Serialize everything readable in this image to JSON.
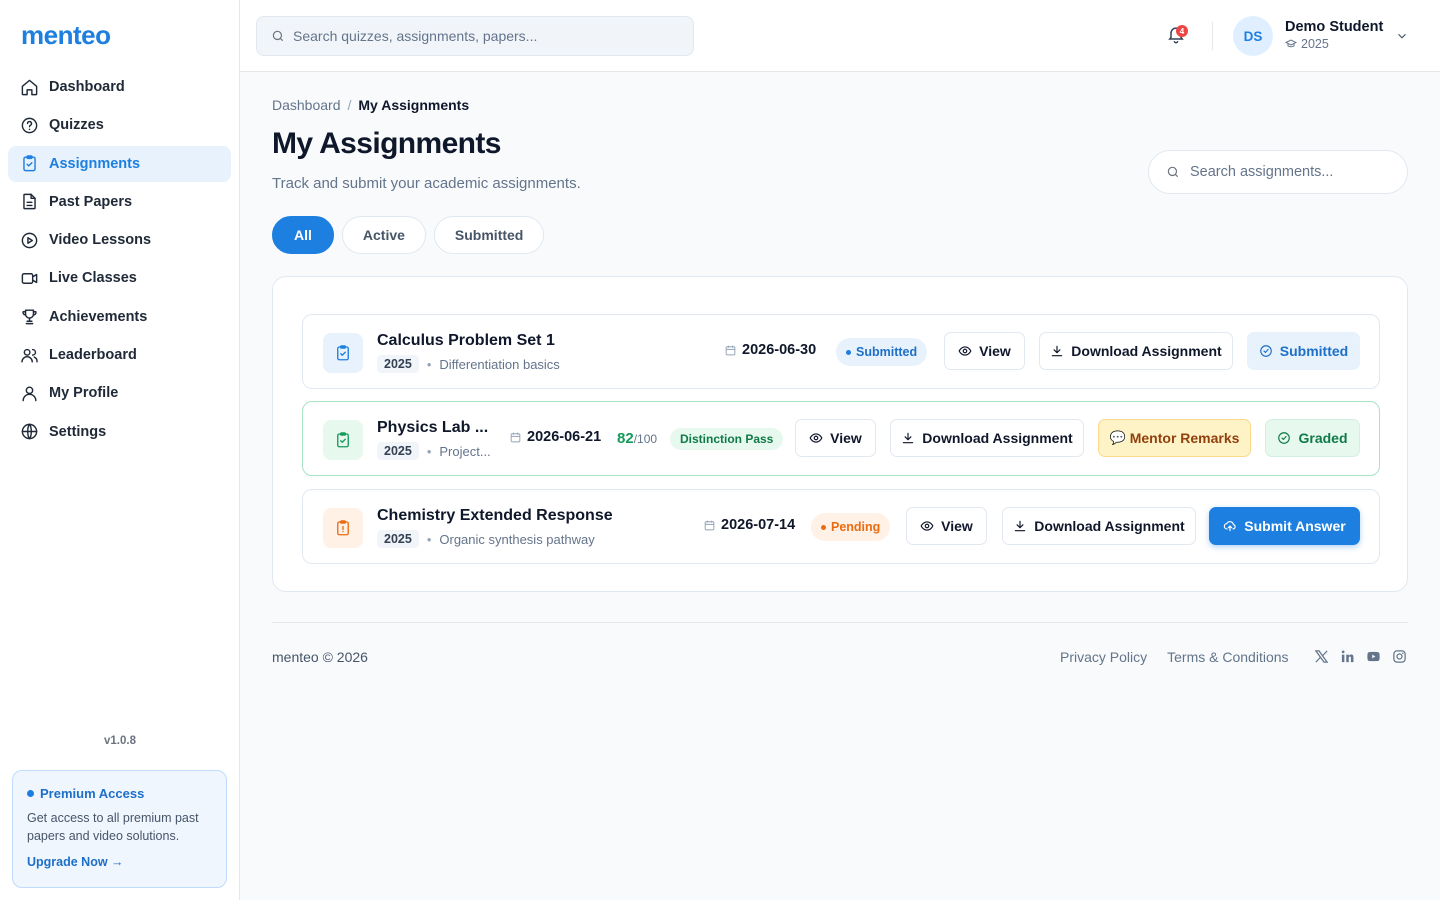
{
  "brand": {
    "logo": "menteo"
  },
  "sidebar": {
    "items": [
      {
        "label": "Dashboard",
        "icon": "home-icon"
      },
      {
        "label": "Quizzes",
        "icon": "question-circle-icon"
      },
      {
        "label": "Assignments",
        "icon": "clipboard-check-icon",
        "active": true
      },
      {
        "label": "Past Papers",
        "icon": "document-icon"
      },
      {
        "label": "Video Lessons",
        "icon": "play-circle-icon"
      },
      {
        "label": "Live Classes",
        "icon": "video-camera-icon"
      },
      {
        "label": "Achievements",
        "icon": "trophy-icon"
      },
      {
        "label": "Leaderboard",
        "icon": "users-icon"
      },
      {
        "label": "My Profile",
        "icon": "user-icon"
      },
      {
        "label": "Settings",
        "icon": "globe-icon"
      }
    ],
    "version": "v1.0.8",
    "premium": {
      "title": "Premium Access",
      "description": "Get access to all premium past papers and video solutions.",
      "link": "Upgrade Now →"
    }
  },
  "header": {
    "search_placeholder": "Search quizzes, assignments, papers...",
    "notifications_count": "4",
    "user": {
      "initials": "DS",
      "name": "Demo Student",
      "year": "2025"
    }
  },
  "page": {
    "breadcrumb": {
      "root": "Dashboard",
      "sep": "/",
      "current": "My Assignments"
    },
    "title": "My Assignments",
    "subtitle": "Track and submit your academic assignments.",
    "search_placeholder": "Search assignments...",
    "tabs": [
      {
        "label": "All",
        "active": true
      },
      {
        "label": "Active",
        "active": false
      },
      {
        "label": "Submitted",
        "active": false
      }
    ]
  },
  "assignments": [
    {
      "title": "Calculus Problem Set 1",
      "year": "2025",
      "topic": "Differentiation basics",
      "due": "2026-06-30",
      "status": "Submitted",
      "view_label": "View",
      "download_label": "Download Assignment",
      "action_label": "Submitted"
    },
    {
      "title": "Physics Lab ...",
      "year": "2025",
      "topic": "Project...",
      "due": "2026-06-21",
      "score": "82",
      "score_max": "/100",
      "grade": "Distinction Pass",
      "view_label": "View",
      "download_label": "Download Assignment",
      "remarks_label": "Mentor Remarks",
      "action_label": "Graded"
    },
    {
      "title": "Chemistry Extended Response",
      "year": "2025",
      "topic": "Organic synthesis pathway",
      "due": "2026-07-14",
      "status": "Pending",
      "view_label": "View",
      "download_label": "Download Assignment",
      "action_label": "Submit Answer"
    }
  ],
  "footer": {
    "copyright": "menteo © 2026",
    "links": [
      "Privacy Policy",
      "Terms & Conditions"
    ],
    "socials": [
      "x-icon",
      "linkedin-icon",
      "youtube-icon",
      "instagram-icon"
    ]
  },
  "colors": {
    "accent": "#1d7fe0",
    "success": "#159a5b",
    "warning": "#ea6c12"
  }
}
